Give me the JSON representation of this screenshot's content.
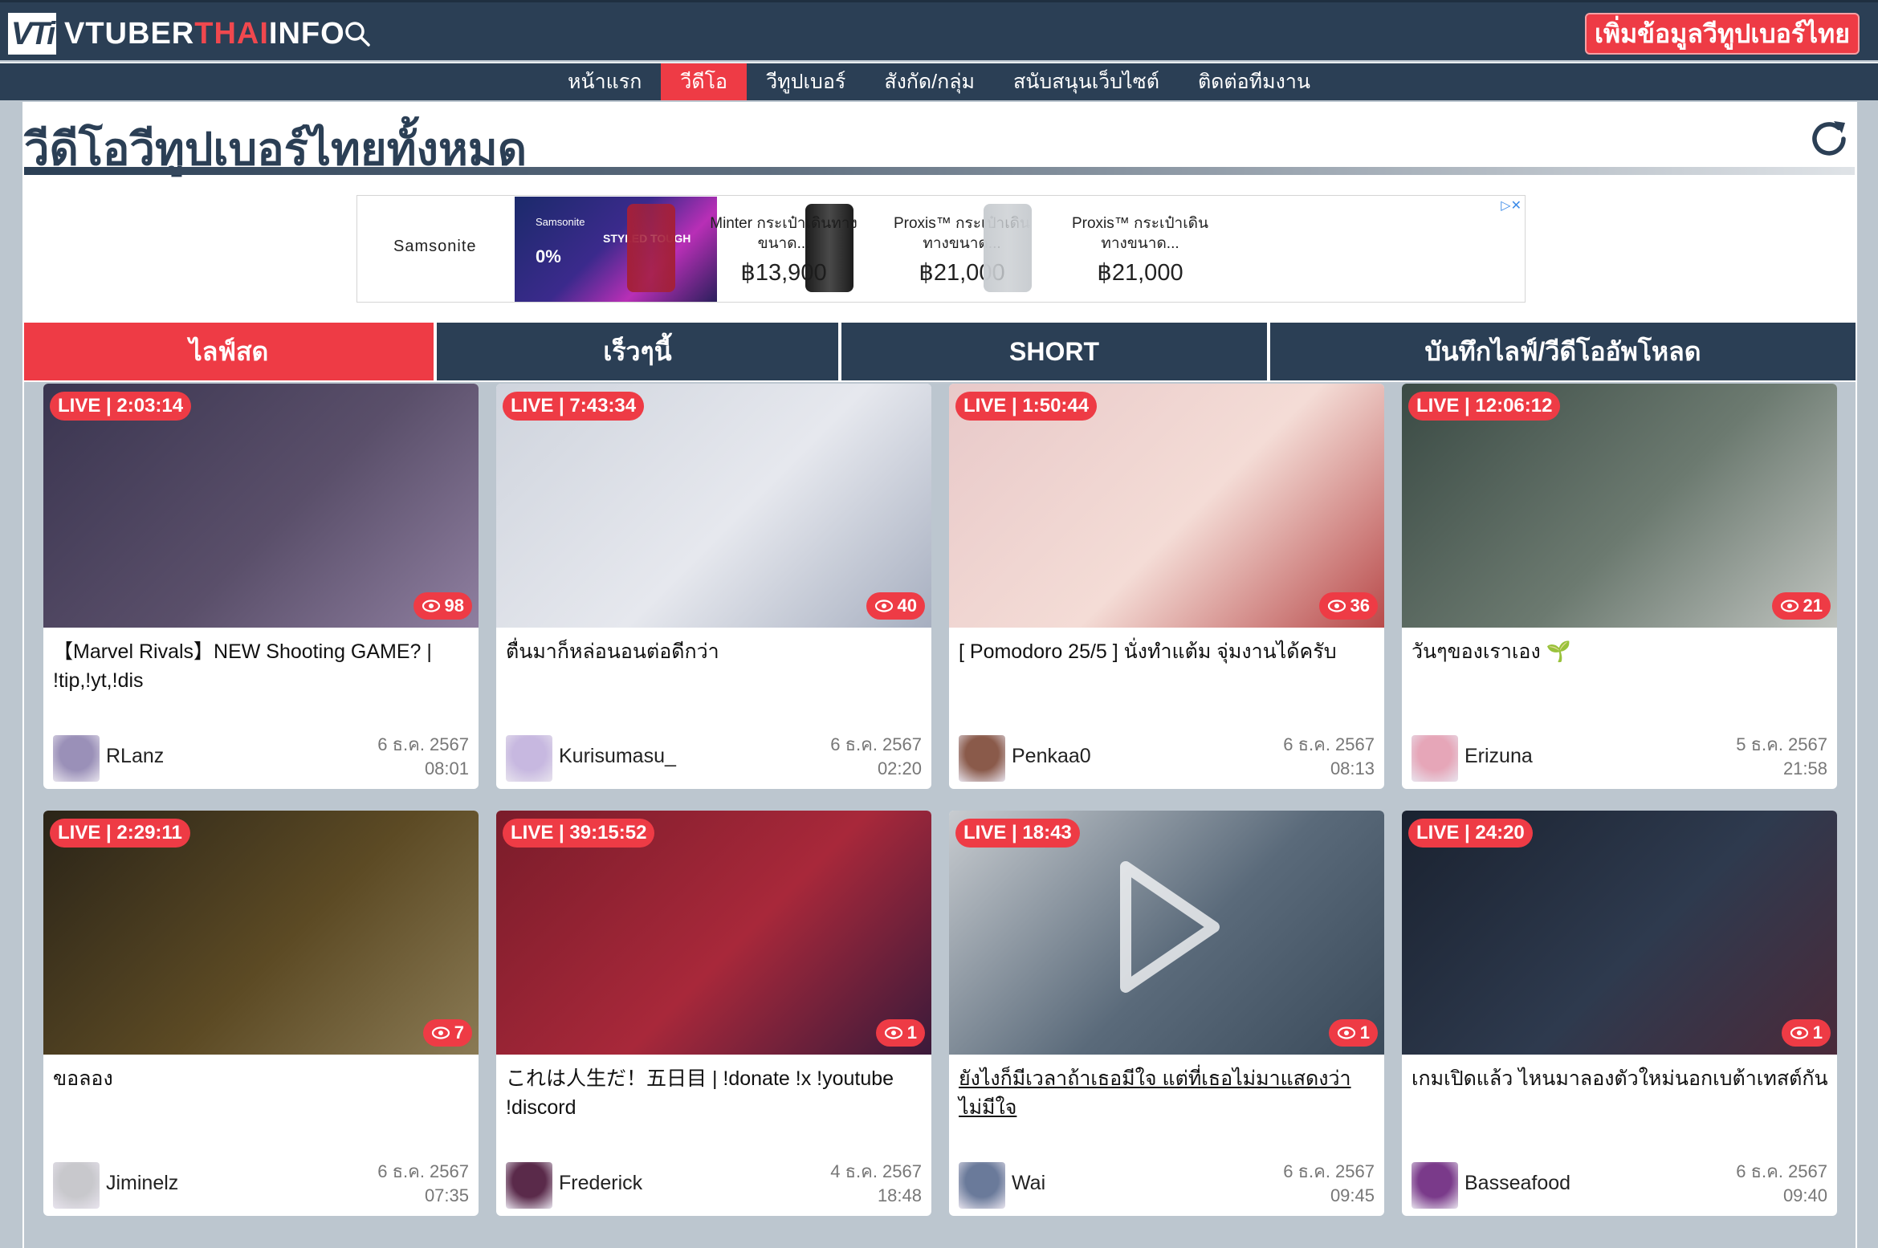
{
  "site": {
    "logo_mark": "VTi",
    "logo_text_a": "VTUBER",
    "logo_text_b": "THAI",
    "logo_text_c": "INFO",
    "add_button": "เพิ่มข้อมูลวีทูปเบอร์ไทย"
  },
  "nav": [
    {
      "label": "หน้าแรก",
      "active": false
    },
    {
      "label": "วีดีโอ",
      "active": true
    },
    {
      "label": "วีทูปเบอร์",
      "active": false
    },
    {
      "label": "สังกัด/กลุ่ม",
      "active": false
    },
    {
      "label": "สนับสนุนเว็บไซต์",
      "active": false
    },
    {
      "label": "ติดต่อทีมงาน",
      "active": false
    }
  ],
  "page": {
    "title": "วีดีโอวีทูปเบอร์ไทยทั้งหมด"
  },
  "ad": {
    "brand": "Samsonite",
    "banner_brand": "Samsonite",
    "banner_slogan": "STYLED TOUGH",
    "banner_pct": "0%",
    "products": [
      {
        "name": "Minter กระเป๋าเดินทางขนาด...",
        "price": "฿13,900",
        "color": "#a4203a"
      },
      {
        "name": "Proxis™ กระเป๋าเดินทางขนาด...",
        "price": "฿21,000",
        "color": "#1c1c1c"
      },
      {
        "name": "Proxis™ กระเป๋าเดินทางขนาด...",
        "price": "฿21,000",
        "color": "#c9cdd1"
      }
    ]
  },
  "tabs": [
    {
      "label": "ไลฟ์สด",
      "active": true
    },
    {
      "label": "เร็วๆนี้",
      "active": false
    },
    {
      "label": "SHORT",
      "active": false
    },
    {
      "label": "บันทึกไลฟ์/วีดีโออัพโหลด",
      "active": false
    }
  ],
  "videos": [
    {
      "live": "LIVE | 2:03:14",
      "views": "98",
      "title": "【Marvel Rivals】NEW Shooting GAME? | !tip,!yt,!dis",
      "channel": "RLanz",
      "date": "6 ธ.ค. 2567",
      "time": "08:01",
      "thumb": [
        "#3a3550",
        "#5a4f6a",
        "#8f7fa0"
      ],
      "avatar": "#9a90b8"
    },
    {
      "live": "LIVE | 7:43:34",
      "views": "40",
      "title": "ตื่นมาก็หล่อนอนต่อดีกว่า",
      "channel": "Kurisumasu_",
      "date": "6 ธ.ค. 2567",
      "time": "02:20",
      "thumb": [
        "#cfd4dd",
        "#e6e8ee",
        "#a7afc0"
      ],
      "avatar": "#c7b8e0"
    },
    {
      "live": "LIVE | 1:50:44",
      "views": "36",
      "title": "[ Pomodoro 25/5 ] นั่งทำแต้ม จุ่มงานได้ครับ",
      "channel": "Penkaa0",
      "date": "6 ธ.ค. 2567",
      "time": "08:13",
      "thumb": [
        "#e8c9c9",
        "#f4dcd6",
        "#b84a4a"
      ],
      "avatar": "#8a5a4a"
    },
    {
      "live": "LIVE | 12:06:12",
      "views": "21",
      "title": "วันๆของเราเอง 🌱",
      "channel": "Erizuna",
      "date": "5 ธ.ค. 2567",
      "time": "21:58",
      "thumb": [
        "#3a4a44",
        "#6c7a70",
        "#c0c4c0"
      ],
      "avatar": "#e6a6b8"
    },
    {
      "live": "LIVE | 2:29:11",
      "views": "7",
      "title": "ขอลอง",
      "channel": "Jiminelz",
      "date": "6 ธ.ค. 2567",
      "time": "07:35",
      "thumb": [
        "#2a2418",
        "#5c4a24",
        "#8a7a54"
      ],
      "avatar": "#c8c8cc"
    },
    {
      "live": "LIVE | 39:15:52",
      "views": "1",
      "title": "これは人生だ！五日目 | !donate !x !youtube !discord",
      "channel": "Frederick",
      "date": "4 ธ.ค. 2567",
      "time": "18:48",
      "thumb": [
        "#7a1c2a",
        "#a8283a",
        "#3a1a3a"
      ],
      "avatar": "#5a2a4a"
    },
    {
      "live": "LIVE | 18:43",
      "views": "1",
      "title": "ยังไงก็มีเวลาถ้าเธอมีใจ แต่ที่เธอไม่มาแสดงว่าไม่มีใจ",
      "channel": "Wai",
      "date": "6 ธ.ค. 2567",
      "time": "09:45",
      "thumb": [
        "#c8ccd0",
        "#5a6a7a",
        "#3a4a5a"
      ],
      "avatar": "#6a7a9a"
    },
    {
      "live": "LIVE | 24:20",
      "views": "1",
      "title": "เกมเปิดแล้ว ไหนมาลองตัวใหม่นอกเบต้าเทสต์กัน",
      "channel": "Basseafood",
      "date": "6 ธ.ค. 2567",
      "time": "09:40",
      "thumb": [
        "#1a2230",
        "#2e3a4e",
        "#4a2a3a"
      ],
      "avatar": "#7a3a8a"
    }
  ]
}
